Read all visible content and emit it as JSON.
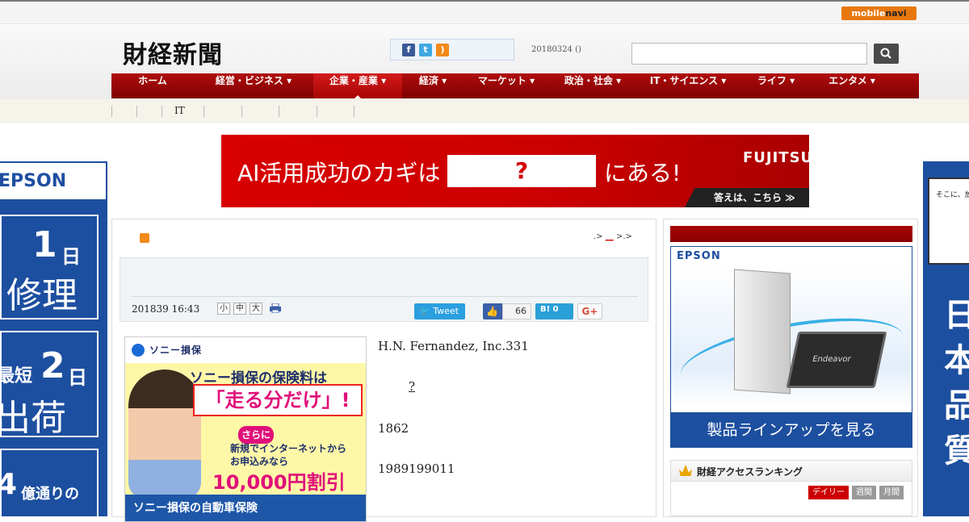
{
  "topbar": {
    "mobilenavi_a": "mobile",
    "mobilenavi_b": "navi"
  },
  "header": {
    "logo": "財経新聞",
    "date": "20180324 ()",
    "search_placeholder": ""
  },
  "nav": {
    "items": [
      {
        "label": "ホーム"
      },
      {
        "label": "経営・ビジネス ▾"
      },
      {
        "label": "企業・産業 ▾"
      },
      {
        "label": "経済 ▾"
      },
      {
        "label": "マーケット ▾"
      },
      {
        "label": "政治・社会 ▾"
      },
      {
        "label": "IT・サイエンス ▾"
      },
      {
        "label": "ライフ ▾"
      },
      {
        "label": "エンタメ ▾"
      }
    ],
    "active_index": 2
  },
  "subnav": {
    "items": [
      "IT"
    ]
  },
  "banner": {
    "text_left": "AI活用成功のカギは",
    "question": "?",
    "text_right": "にある!",
    "brand": "FUJITSU",
    "cta": "答えは、こちら ≫"
  },
  "left_ad": {
    "brand": "EPSON",
    "box1_big": "1",
    "box1_unit": "日",
    "box1_text": "修理",
    "box2_prefix": "最短",
    "box2_big": "2",
    "box2_unit": "日",
    "box2_text": "出荷",
    "box3_big": "4",
    "box3_text": "億通りの"
  },
  "right_ad": {
    "bubble": "そこに、放",
    "chars": [
      "日",
      "本",
      "品",
      "質"
    ]
  },
  "article": {
    "breadcrumb_a": ".>",
    "breadcrumb_link": "__",
    "breadcrumb_b": ">.>",
    "datetime": "201839 16:43",
    "font_sizes": [
      "小",
      "中",
      "大"
    ],
    "tweet_label": "Tweet",
    "like_count": "66",
    "hatena_label": "B! 0",
    "gplus_label": "G+",
    "paragraphs": [
      "H.N. Fernandez, Inc.331",
      "?",
      "1862",
      "1989199011"
    ]
  },
  "sony_ad": {
    "logo": "ソニー損保",
    "line1": "ソニー損保の保険料は",
    "line2": "「走る分だけ」!",
    "badge": "さらに",
    "line4a": "新規でインターネットから",
    "line4b": "お申込みなら",
    "line5": "10,000円割引",
    "bottom": "ソニー損保の自動車保険"
  },
  "sidebar": {
    "epson_brand": "EPSON",
    "epson_laptop": "Endeavor",
    "epson_cta": "製品ラインアップを見る",
    "ranking_title": "財経アクセスランキング",
    "ranking_tabs": [
      "デイリー",
      "週間",
      "月間"
    ]
  },
  "colors": {
    "nav_red": "#9c0404",
    "epson_blue": "#1d4fa0",
    "mobilenavi_orange": "#e8780e",
    "fujitsu_red": "#cc0000"
  }
}
